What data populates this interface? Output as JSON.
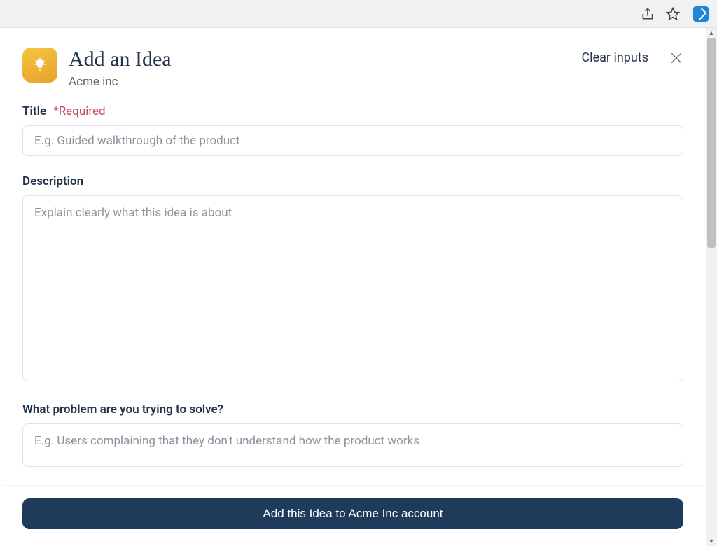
{
  "header": {
    "title": "Add an Idea",
    "subtitle": "Acme inc",
    "clear_label": "Clear inputs"
  },
  "fields": {
    "title": {
      "label": "Title",
      "required_mark": "*Required",
      "placeholder": "E.g. Guided walkthrough of the product",
      "value": ""
    },
    "description": {
      "label": "Description",
      "placeholder": "Explain clearly what this idea is about",
      "value": ""
    },
    "problem": {
      "label": "What problem are you trying to solve?",
      "placeholder": "E.g. Users complaining that they don't understand how the product works",
      "value": ""
    }
  },
  "footer": {
    "submit_label": "Add this Idea to Acme Inc account"
  }
}
